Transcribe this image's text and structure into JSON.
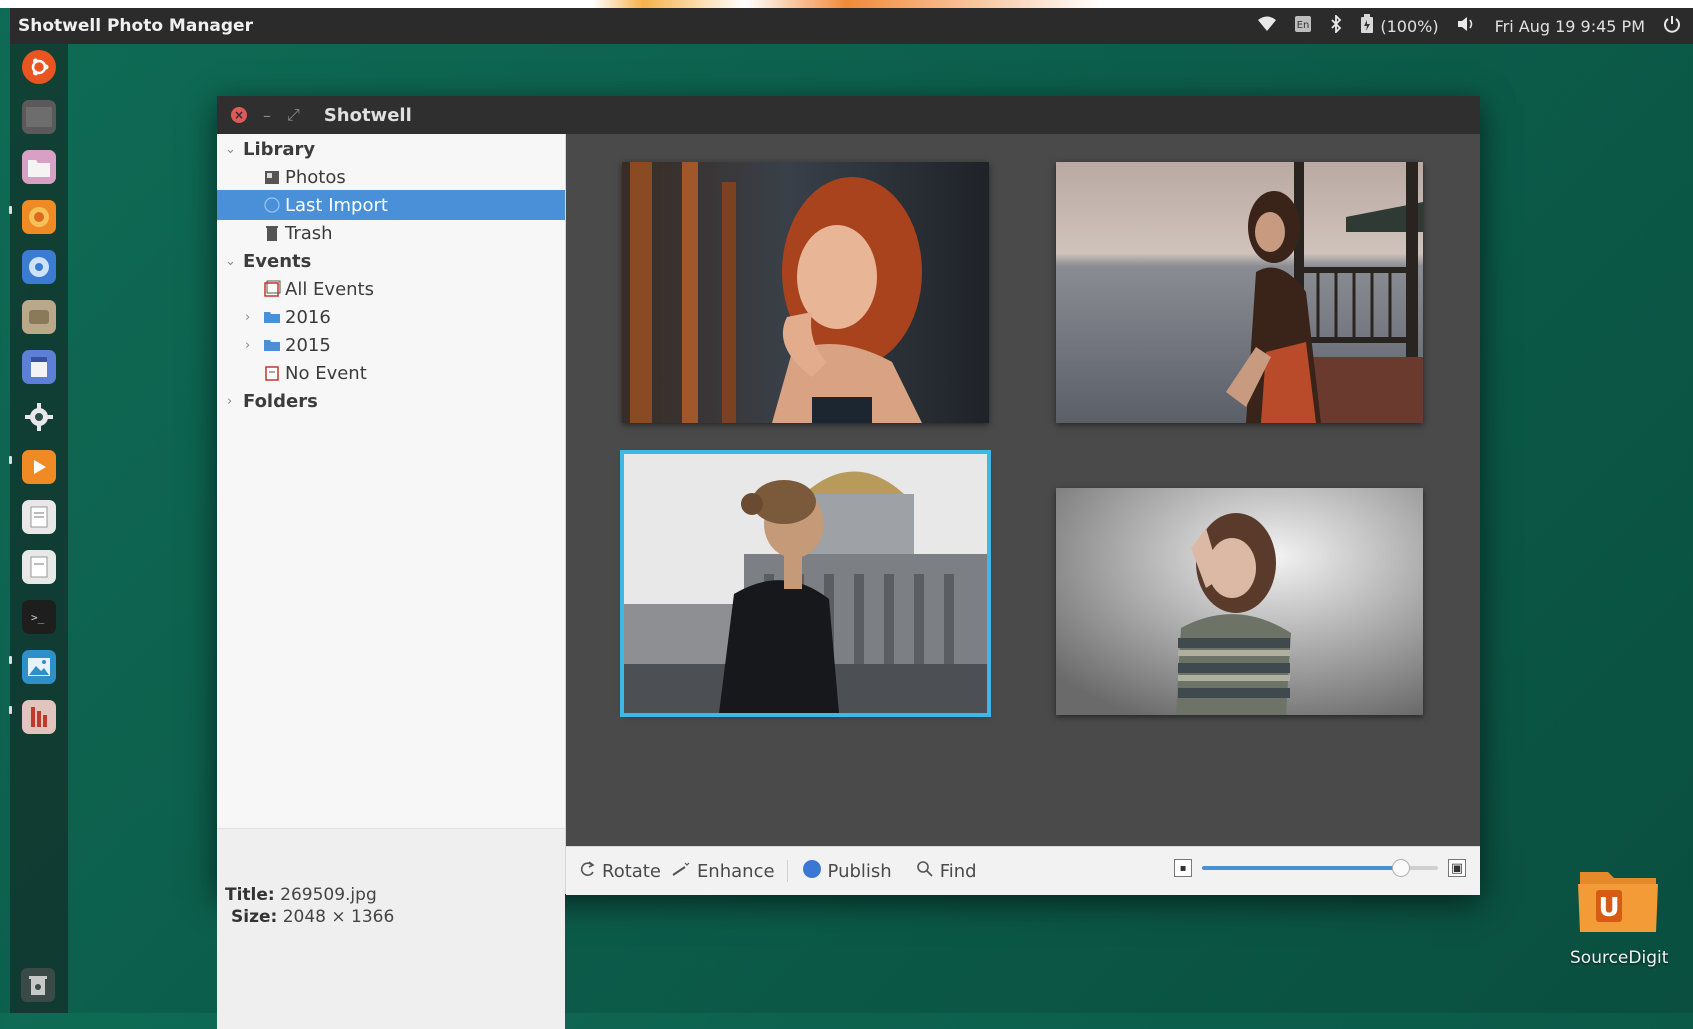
{
  "top_panel": {
    "app_title": "Shotwell Photo Manager",
    "battery_text": "(100%)",
    "clock_text": "Fri Aug 19  9:45 PM"
  },
  "window": {
    "title": "Shotwell"
  },
  "sidebar": {
    "library_label": "Library",
    "photos_label": "Photos",
    "last_import_label": "Last Import",
    "trash_label": "Trash",
    "events_label": "Events",
    "all_events_label": "All Events",
    "year_2016_label": "2016",
    "year_2015_label": "2015",
    "no_event_label": "No Event",
    "folders_label": "Folders",
    "info": {
      "title_key": "Title:",
      "title_value": "269509.jpg",
      "size_key": "Size:",
      "size_value": "2048 × 1366"
    }
  },
  "toolbar": {
    "rotate_label": "Rotate",
    "enhance_label": "Enhance",
    "publish_label": "Publish",
    "find_label": "Find",
    "zoom_level": 0.84
  },
  "desktop": {
    "folder_label": "SourceDigit",
    "folder_badge": "U"
  },
  "colors": {
    "selection": "#4a90d9",
    "photo_selected_border": "#3fb8e6",
    "close_button": "#e05a5a",
    "launcher_ubuntu": "#e95420"
  }
}
